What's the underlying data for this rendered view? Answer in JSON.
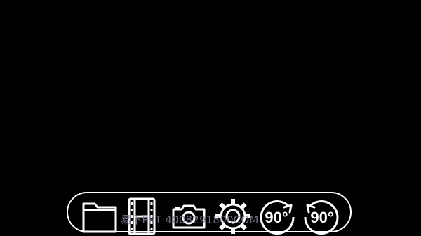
{
  "toolbar": {
    "items": [
      {
        "icon": "folder-icon"
      },
      {
        "icon": "film-icon"
      },
      {
        "icon": "camera-icon"
      },
      {
        "icon": "settings-gear-icon"
      },
      {
        "icon": "rotate-clockwise-icon",
        "label": "90°"
      },
      {
        "icon": "rotate-counterclockwise-icon",
        "label": "90°"
      }
    ]
  },
  "watermark": {
    "text": "易下PPT 4008291800COM"
  },
  "colors": {
    "background": "#000000",
    "icon_stroke": "#ffffff",
    "watermark": "#8a7f9c"
  }
}
